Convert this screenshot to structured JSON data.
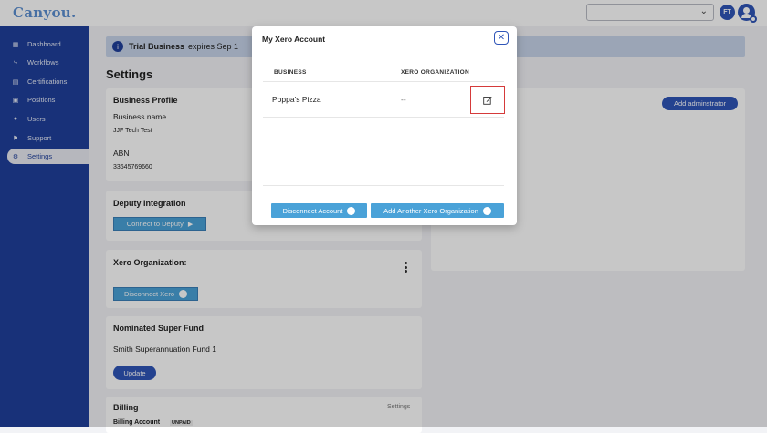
{
  "app": {
    "logo": "Canyou.",
    "avatar_initials": "FT"
  },
  "sidebar": {
    "items": [
      {
        "label": "Dashboard",
        "icon": "grid-icon"
      },
      {
        "label": "Workflows",
        "icon": "workflow-icon"
      },
      {
        "label": "Certifications",
        "icon": "certificate-icon"
      },
      {
        "label": "Positions",
        "icon": "briefcase-icon"
      },
      {
        "label": "Users",
        "icon": "user-icon"
      },
      {
        "label": "Support",
        "icon": "support-icon"
      },
      {
        "label": "Settings",
        "icon": "gear-icon"
      }
    ]
  },
  "banner": {
    "title": "Trial Business",
    "expires": "expires Sep 1"
  },
  "page": {
    "title": "Settings"
  },
  "business_profile": {
    "title": "Business Profile",
    "name_label": "Business name",
    "name_value": "JJF Tech Test",
    "abn_label": "ABN",
    "abn_value": "33645769660"
  },
  "deputy": {
    "title": "Deputy Integration",
    "connect_label": "Connect to Deputy"
  },
  "xero_card": {
    "title": "Xero Organization:",
    "disconnect_label": "Disconnect Xero"
  },
  "super_fund": {
    "title": "Nominated Super Fund",
    "value": "Smith Superannuation Fund 1",
    "update_label": "Update"
  },
  "billing": {
    "title": "Billing",
    "settings_link": "Settings",
    "account_label": "Billing Account",
    "status": "UNPAID"
  },
  "admin": {
    "add_label": "Add adminstrator"
  },
  "modal": {
    "title": "My Xero Account",
    "col_business": "BUSINESS",
    "col_xero_org": "XERO ORGANIZATION",
    "rows": [
      {
        "business": "Poppa's Pizza",
        "xero_org": "--"
      }
    ],
    "disconnect_label": "Disconnect Account",
    "add_another_label": "Add Another Xero Organization"
  },
  "colors": {
    "sidebar": "#1f3f9c",
    "accent_button": "#4aa2d8",
    "primary": "#2f55b8",
    "highlight_border": "#d53a3a"
  }
}
